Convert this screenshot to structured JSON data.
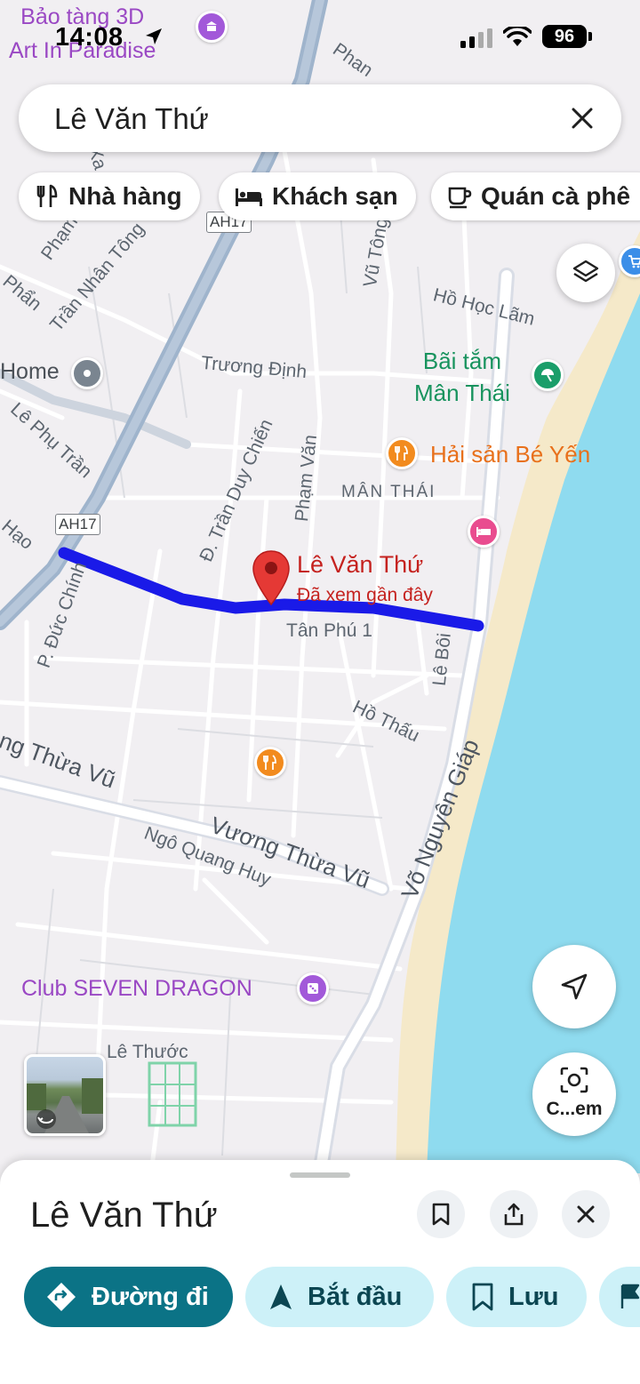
{
  "status_bar": {
    "time": "14:08",
    "battery": "96"
  },
  "search": {
    "value": "Lê Văn Thứ"
  },
  "chips": [
    {
      "label": "Nhà hàng",
      "icon": "fork-knife-icon"
    },
    {
      "label": "Khách sạn",
      "icon": "bed-icon"
    },
    {
      "label": "Quán cà phê",
      "icon": "coffee-cup-icon"
    }
  ],
  "map": {
    "road_badges": [
      "AH17",
      "AH17"
    ],
    "streets": {
      "phan1": "Phan",
      "phan2": "Phạm",
      "xa": "Xa",
      "phan3": "Phẩn",
      "tran_nhan_tong": "Trần Nhân Tông",
      "vu_tong": "Vũ Tông",
      "ho_hoc_lam": "Hồ Học Lãm",
      "truong_dinh": "Trương Định",
      "le_phu_tran": "Lê Phụ Trần",
      "hao": "Hạo",
      "tran_duy_chien": "Đ. Trần Duy Chiến",
      "pham_van": "Phạm Văn",
      "duc_chinh": "P. Đức Chính",
      "tan_phu": "Tân Phú 1",
      "le_boi": "Lê Bôi",
      "ho_thau": "Hồ Thấu",
      "vo_nguyen_giap": "Võ Nguyên Giáp",
      "thua_vu": "ng Thừa Vũ",
      "vuong_thua_vu": "Vương Thừa Vũ",
      "ngo_quang_huy": "Ngô Quang Huy",
      "le_thuoc": "Lê Thước"
    },
    "district": "MÂN THÁI",
    "pois": {
      "museum": "Bảo tàng 3D\nArt In Paradise",
      "home": "Home",
      "beach": "Bãi tắm\nMân Thái",
      "seafood": "Hải sản Bé Yến",
      "club": "Club SEVEN DRAGON"
    },
    "pin": {
      "title": "Lê Văn Thứ",
      "subtitle": "Đã xem gần đây"
    }
  },
  "lens_label": "C...em",
  "sheet": {
    "title": "Lê Văn Thứ",
    "actions": [
      {
        "label": "Đường đi",
        "icon": "directions-icon"
      },
      {
        "label": "Bắt đầu",
        "icon": "navigation-arrow-icon"
      },
      {
        "label": "Lưu",
        "icon": "bookmark-icon"
      }
    ]
  },
  "colors": {
    "route": "#1a1ae8",
    "water": "#8fdbef",
    "beach": "#f5e9c9",
    "accent": "#0b7386",
    "pin": "#e53935"
  }
}
